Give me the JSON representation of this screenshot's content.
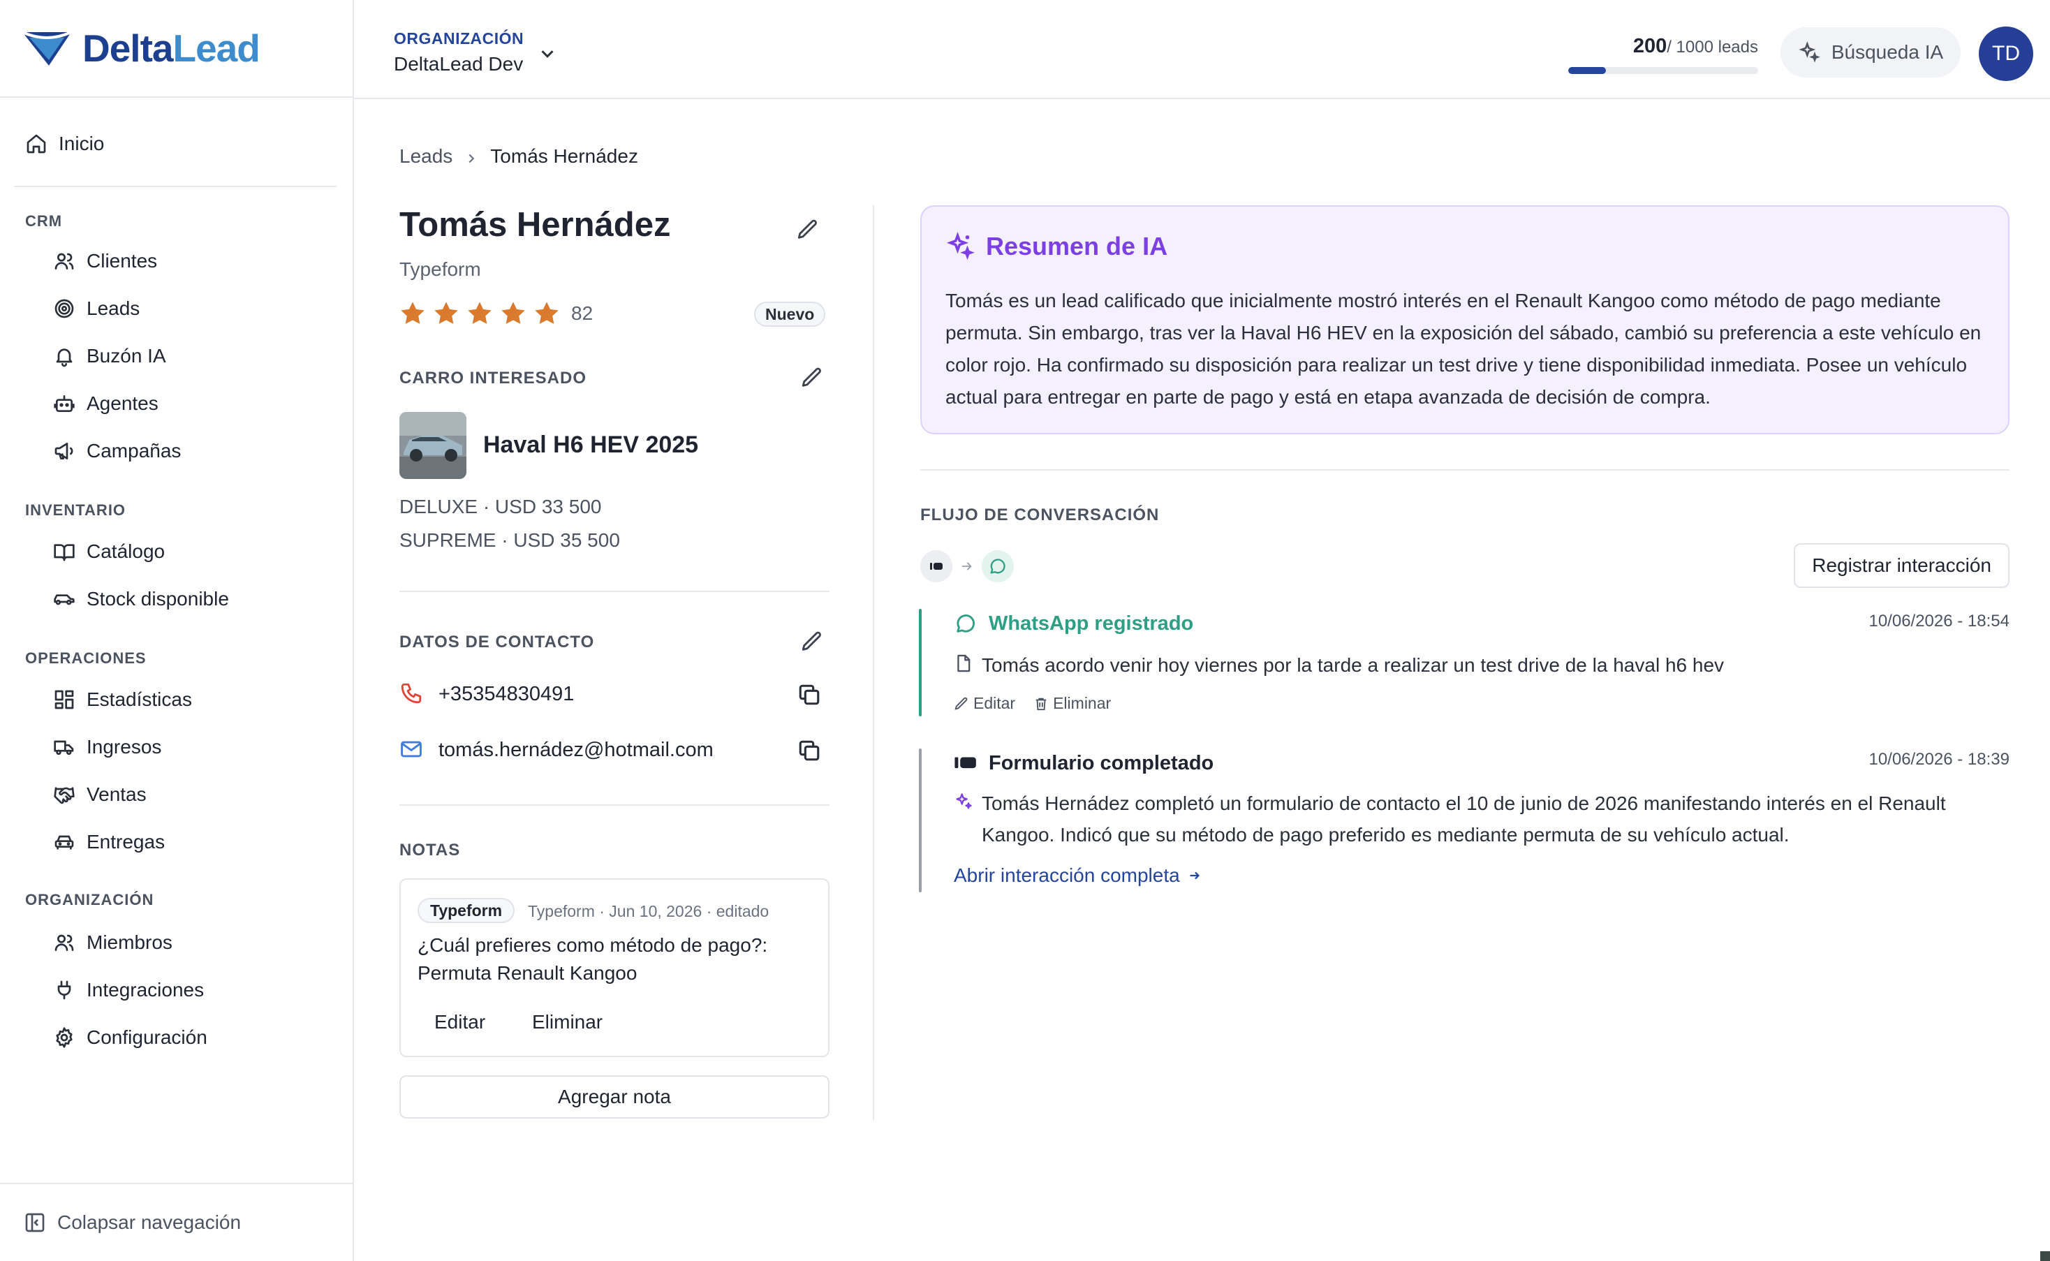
{
  "brand": {
    "name_part1": "Delta",
    "name_part2": "Lead",
    "color_dark": "#1c3f8f",
    "color_light": "#3d8ccd"
  },
  "sidebar": {
    "home": {
      "label": "Inicio",
      "icon": "home-icon"
    },
    "sections": [
      {
        "title": "CRM",
        "items": [
          {
            "label": "Clientes",
            "icon": "users-icon"
          },
          {
            "label": "Leads",
            "icon": "target-icon"
          },
          {
            "label": "Buzón IA",
            "icon": "bell-icon"
          },
          {
            "label": "Agentes",
            "icon": "bot-icon"
          },
          {
            "label": "Campañas",
            "icon": "megaphone-icon"
          }
        ]
      },
      {
        "title": "INVENTARIO",
        "items": [
          {
            "label": "Catálogo",
            "icon": "book-open-icon"
          },
          {
            "label": "Stock disponible",
            "icon": "car-icon"
          }
        ]
      },
      {
        "title": "OPERACIONES",
        "items": [
          {
            "label": "Estadísticas",
            "icon": "dashboard-icon"
          },
          {
            "label": "Ingresos",
            "icon": "truck-icon"
          },
          {
            "label": "Ventas",
            "icon": "handshake-icon"
          },
          {
            "label": "Entregas",
            "icon": "car-front-icon"
          }
        ]
      },
      {
        "title": "ORGANIZACIÓN",
        "items": [
          {
            "label": "Miembros",
            "icon": "users-icon"
          },
          {
            "label": "Integraciones",
            "icon": "plug-icon"
          },
          {
            "label": "Configuración",
            "icon": "gear-icon"
          }
        ]
      }
    ],
    "collapse_label": "Colapsar navegación"
  },
  "header": {
    "org_label": "ORGANIZACIÓN",
    "org_name": "DeltaLead Dev",
    "leads_used": "200",
    "leads_total": "/ 1000 leads",
    "leads_progress_fraction": 0.2,
    "ai_search_label": "Búsqueda IA",
    "avatar_initials": "TD",
    "accent": "#24459b"
  },
  "breadcrumb": {
    "parent": "Leads",
    "current": "Tomás Hernádez"
  },
  "lead": {
    "name": "Tomás Hernádez",
    "source": "Typeform",
    "rating_stars": 5,
    "score": "82",
    "status_badge": "Nuevo",
    "car_section_label": "CARRO INTERESADO",
    "car_name": "Haval H6 HEV 2025",
    "car_variants": [
      "DELUXE · USD 33 500",
      "SUPREME · USD 35 500"
    ],
    "contact_section_label": "DATOS DE CONTACTO",
    "phone": "+35354830491",
    "email": "tomás.hernádez@hotmail.com",
    "notes_section_label": "NOTAS",
    "note": {
      "tag": "Typeform",
      "meta": "Typeform · Jun 10, 2026 · editado",
      "text": "¿Cuál prefieres como método de pago?: Permuta Renault Kangoo",
      "edit_label": "Editar",
      "delete_label": "Eliminar"
    },
    "add_note_label": "Agregar nota"
  },
  "ai_summary": {
    "title": "Resumen de IA",
    "text": "Tomás es un lead calificado que inicialmente mostró interés en el Renault Kangoo como método de pago mediante permuta. Sin embargo, tras ver la Haval H6 HEV en la exposición del sábado, cambió su preferencia a este vehículo en color rojo. Ha confirmado su disposición para realizar un test drive y tiene disponibilidad inmediata. Posee un vehículo actual para entregar en parte de pago y está en etapa avanzada de decisión de compra.",
    "accent": "#7b3fe4"
  },
  "conversation": {
    "section_label": "FLUJO DE CONVERSACIÓN",
    "register_label": "Registrar interacción",
    "events": [
      {
        "title": "WhatsApp registrado",
        "date": "10/06/2026 - 18:54",
        "text": "Tomás acordo venir hoy viernes por la tarde a realizar un test drive de la haval h6 hev",
        "edit_label": "Editar",
        "delete_label": "Eliminar",
        "color": "#2e9e84"
      },
      {
        "title": "Formulario completado",
        "date": "10/06/2026 - 18:39",
        "text": "Tomás Hernádez completó un formulario de contacto el 10 de junio de 2026 manifestando interés en el Renault Kangoo. Indicó que su método de pago preferido es mediante permuta de su vehículo actual.",
        "link_label": "Abrir interacción completa"
      }
    ]
  }
}
